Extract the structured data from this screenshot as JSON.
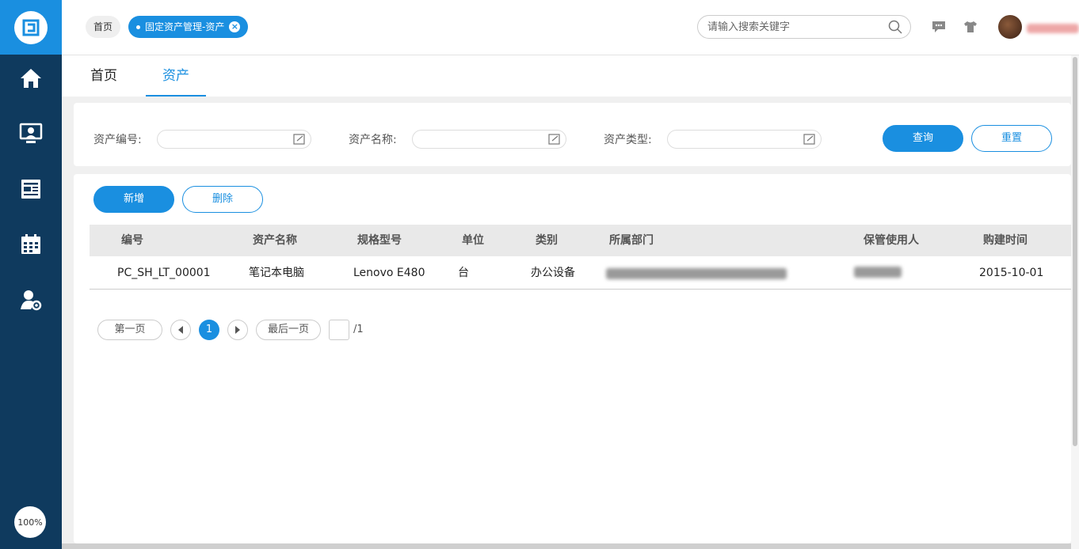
{
  "sidebar": {
    "zoom": "100%",
    "items": [
      {
        "icon": "home-icon"
      },
      {
        "icon": "monitor-user-icon"
      },
      {
        "icon": "document-list-icon"
      },
      {
        "icon": "calendar-icon"
      },
      {
        "icon": "user-settings-icon"
      }
    ]
  },
  "topbar": {
    "tag_home": "首页",
    "tag_active": "固定资产管理-资产",
    "search_placeholder": "请输入搜索关键字"
  },
  "tabs": [
    {
      "label": "首页"
    },
    {
      "label": "资产"
    }
  ],
  "filters": {
    "asset_no_label": "资产编号:",
    "asset_name_label": "资产名称:",
    "asset_type_label": "资产类型:",
    "query_button": "查询",
    "reset_button": "重置"
  },
  "actions": {
    "add_button": "新增",
    "delete_button": "删除"
  },
  "table": {
    "headers": [
      "编号",
      "资产名称",
      "规格型号",
      "单位",
      "类别",
      "所属部门",
      "保管使用人",
      "购建时间"
    ],
    "rows": [
      {
        "no": "PC_SH_LT_00001",
        "name": "笔记本电脑",
        "model": "Lenovo E480",
        "unit": "台",
        "category": "办公设备",
        "purchase_date": "2015-10-01"
      }
    ]
  },
  "pager": {
    "first": "第一页",
    "current": "1",
    "last": "最后一页",
    "total": "/1"
  },
  "colors": {
    "accent": "#1a8fe0",
    "sidebar": "#0f3a5e"
  }
}
